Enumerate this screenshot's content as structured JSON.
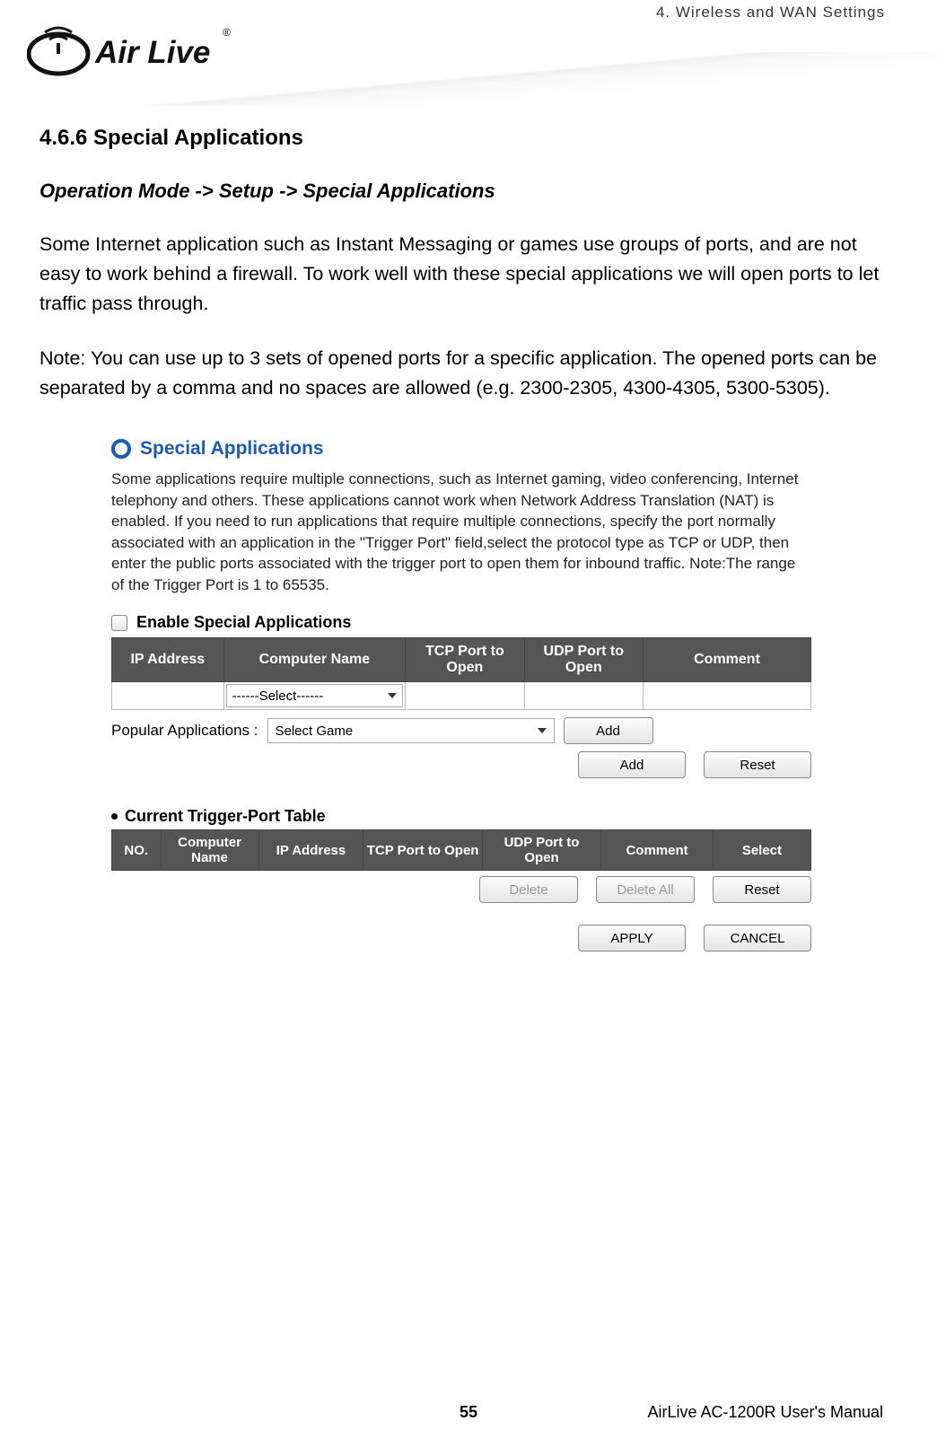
{
  "header": {
    "chapter": "4. Wireless and WAN Settings",
    "logoAlt": "Air Live"
  },
  "section": {
    "heading": "4.6.6 Special Applications",
    "breadcrumb": "Operation Mode -> Setup -> Special Applications",
    "para1": "Some Internet application such as Instant Messaging or games use groups of ports, and are not easy to work behind a firewall. To work well with these special applications we will open ports to let traffic pass through.",
    "para2": "Note: You can use up to 3 sets of opened ports for a specific application. The opened ports can be separated by a comma and no spaces are allowed (e.g. 2300-2305, 4300-4305, 5300-5305)."
  },
  "panel": {
    "title": "Special Applications",
    "desc": "Some applications require multiple connections, such as Internet gaming, video conferencing, Internet telephony and others. These applications cannot work when Network Address Translation (NAT) is enabled. If you need to run applications that require multiple connections, specify the port normally associated with an application in the \"Trigger Port\" field,select the protocol type as TCP or UDP, then enter the public ports associated with the trigger port to open them for inbound traffic. Note:The range of the Trigger Port is 1 to 65535.",
    "enableLabel": "Enable Special Applications",
    "cols": {
      "ip": "IP Address",
      "cname": "Computer Name",
      "tcp": "TCP Port to Open",
      "udp": "UDP Port to Open",
      "comment": "Comment"
    },
    "selectPlaceholder": "------Select------",
    "popularLabel": "Popular Applications :",
    "popularPlaceholder": "Select Game",
    "buttons": {
      "addSmall": "Add",
      "add": "Add",
      "reset": "Reset",
      "delete": "Delete",
      "deleteAll": "Delete All",
      "reset2": "Reset",
      "apply": "APPLY",
      "cancel": "CANCEL"
    },
    "triggerHeader": "Current Trigger-Port Table",
    "triggerCols": {
      "no": "NO.",
      "cname": "Computer Name",
      "ip": "IP Address",
      "tcp": "TCP Port to Open",
      "udp": "UDP Port to Open",
      "comment": "Comment",
      "select": "Select"
    }
  },
  "footer": {
    "page": "55",
    "manual": "AirLive AC-1200R User's Manual"
  }
}
